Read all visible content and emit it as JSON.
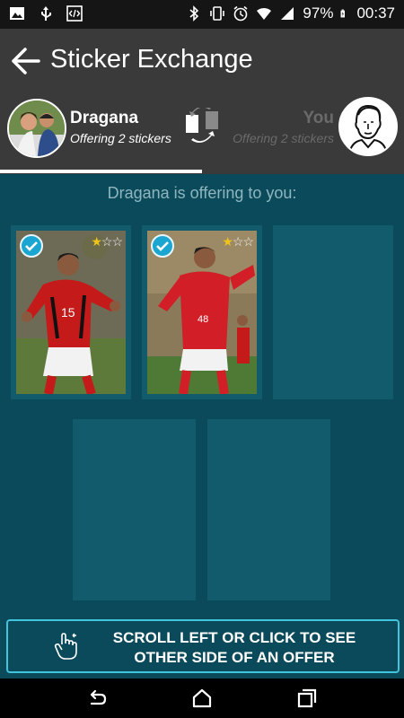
{
  "status_bar": {
    "battery": "97%",
    "time": "00:37",
    "left_icons": [
      "image-icon",
      "usb-icon",
      "code-icon"
    ],
    "right_icons": [
      "bluetooth-icon",
      "vibrate-icon",
      "alarm-icon",
      "wifi-icon",
      "signal-icon",
      "battery-charging-icon"
    ]
  },
  "app_bar": {
    "title": "Sticker Exchange"
  },
  "users": {
    "left": {
      "name": "Dragana",
      "subtitle": "Offering 2 stickers"
    },
    "right": {
      "name": "You",
      "subtitle": "Offering 2 stickers"
    }
  },
  "offer": {
    "heading": "Dragana is offering to you:",
    "stickers": [
      {
        "selected": true,
        "stars": 1,
        "max_stars": 3
      },
      {
        "selected": true,
        "stars": 1,
        "max_stars": 3
      }
    ]
  },
  "banner": {
    "line1": "SCROLL LEFT OR CLICK TO SEE",
    "line2": "OTHER SIDE OF AN OFFER"
  },
  "colors": {
    "background": "#0b4a5a",
    "slot": "#125b6c",
    "accent": "#43c3dc",
    "header": "#3a3a3a"
  }
}
